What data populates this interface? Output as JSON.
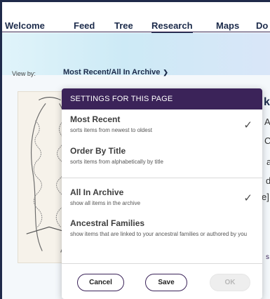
{
  "nav": {
    "items": [
      {
        "label": "Welcome"
      },
      {
        "label": "Feed"
      },
      {
        "label": "Tree"
      },
      {
        "label": "Research"
      },
      {
        "label": "Maps"
      },
      {
        "label": "Do"
      }
    ],
    "active_index": 3
  },
  "view_by": {
    "label": "View by:",
    "value": "Most Recent/All In Archive"
  },
  "background_text": {
    "title_fragment": "k",
    "lines": [
      "A",
      "C",
      "a",
      "d",
      "e]",
      "s"
    ]
  },
  "popup": {
    "header": "SETTINGS FOR THIS PAGE",
    "sort_options": [
      {
        "title": "Most Recent",
        "description": "sorts items from newest to oldest",
        "checked": true
      },
      {
        "title": "Order By Title",
        "description": "sorts items from alphabetically by title",
        "checked": false
      }
    ],
    "filter_options": [
      {
        "title": "All In Archive",
        "description": "show all items in the archive",
        "checked": true
      },
      {
        "title": "Ancestral Families",
        "description": "show items that are linked to your ancestral families or authored by you",
        "checked": false
      }
    ],
    "buttons": {
      "cancel": "Cancel",
      "save": "Save",
      "ok": "OK"
    }
  },
  "colors": {
    "popup_header": "#3b2359",
    "nav_text": "#1c2b4b"
  }
}
